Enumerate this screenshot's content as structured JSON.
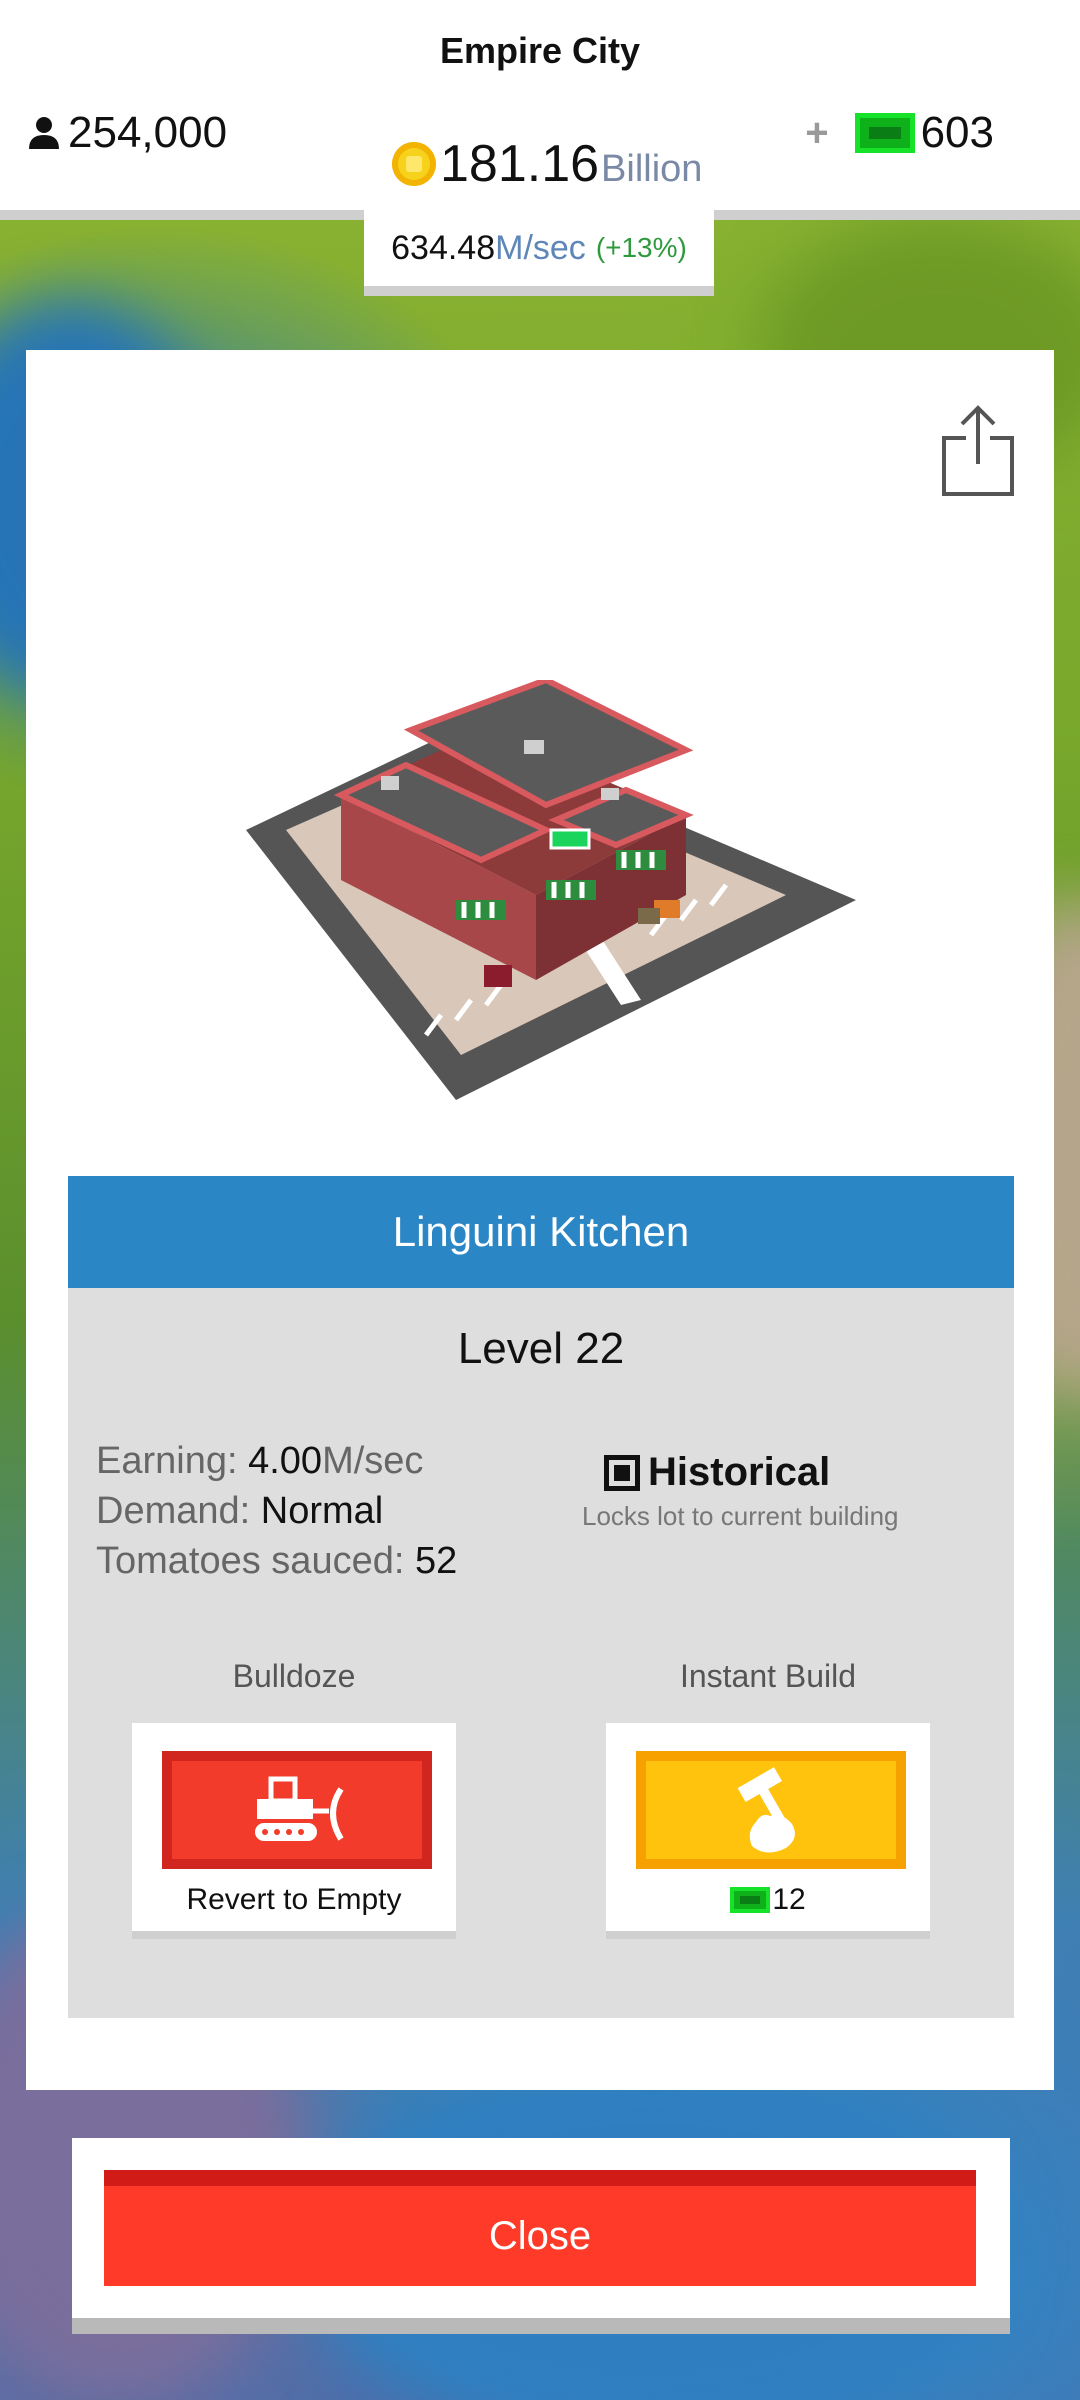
{
  "header": {
    "city_name": "Empire City",
    "population": "254,000",
    "cash_value": "181.16",
    "cash_unit": "Billion",
    "bucks_plus": "+",
    "bucks": "603",
    "rate_value": "634.48",
    "rate_unit": "M/sec",
    "rate_change": "(+13%)"
  },
  "building": {
    "name": "Linguini Kitchen",
    "level": "Level 22",
    "stats": {
      "earning_label": "Earning:",
      "earning_value": "4.00",
      "earning_unit": "M/sec",
      "demand_label": "Demand:",
      "demand_value": "Normal",
      "sauced_label": "Tomatoes sauced:",
      "sauced_value": "52"
    },
    "historical": {
      "title": "Historical",
      "subtitle": "Locks lot to current building",
      "checked": true
    }
  },
  "actions": {
    "bulldoze": {
      "label": "Bulldoze",
      "caption": "Revert to Empty",
      "icon": "bulldozer-icon"
    },
    "instant_build": {
      "label": "Instant Build",
      "cost": "12",
      "icon": "hammer-hand-icon"
    }
  },
  "close_label": "Close",
  "colors": {
    "header_blue": "#2a86c5",
    "close_red": "#ff3a29",
    "bulldoze_red": "#f23b2b",
    "instant_yellow": "#ffc20d",
    "bucks_green": "#0fb11a"
  }
}
